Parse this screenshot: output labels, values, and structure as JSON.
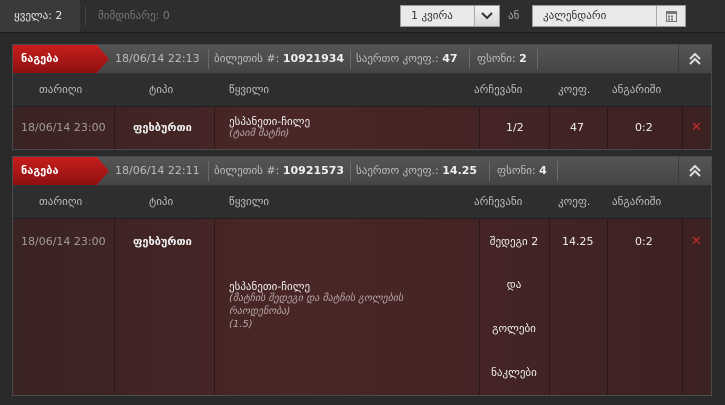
{
  "topbar": {
    "tab_all": "ყველა: 2",
    "tab_pending": "მიმდინარე: 0",
    "period_select": "1 კვირა",
    "and_label": "ან",
    "calendar_field": "კალენდარი"
  },
  "bets": [
    {
      "badge": "ნაგება",
      "datetime": "18/06/14 22:13",
      "ticket_label": "ბილეთის #:",
      "ticket_no": "10921934",
      "odds_label": "საერთო კოეფ.:",
      "odds": "47",
      "stake_label": "ფსონი:",
      "stake": "2",
      "columns": {
        "date": "თარიღი",
        "type": "ტიპი",
        "event": "წყვილი",
        "choice": "არჩევანი",
        "coef": "კოეფ.",
        "score": "ანგარიში"
      },
      "row": {
        "date": "18/06/14 23:00",
        "type": "ფეხბურთი",
        "event": "ესპანეთი-ჩილე",
        "market": "(ტაიმ მატჩი)",
        "choice": "1/2",
        "coef": "47",
        "score": "0:2"
      }
    },
    {
      "badge": "ნაგება",
      "datetime": "18/06/14 22:11",
      "ticket_label": "ბილეთის #:",
      "ticket_no": "10921573",
      "odds_label": "საერთო კოეფ.:",
      "odds": "14.25",
      "stake_label": "ფსონი:",
      "stake": "4",
      "columns": {
        "date": "თარიღი",
        "type": "ტიპი",
        "event": "წყვილი",
        "choice": "არჩევანი",
        "coef": "კოეფ.",
        "score": "ანგარიში"
      },
      "row": {
        "date": "18/06/14 23:00",
        "type": "ფეხბურთი",
        "event": "ესპანეთი-ჩილე",
        "market_line1": "(მატჩის შედეგი და მატჩის გოლების",
        "market_line2": "რაოდენობა)",
        "market_line3": "(1.5)",
        "choice_lines": [
          "შედეგი 2",
          "და",
          "გოლები",
          "ნაკლები"
        ],
        "coef": "14.25",
        "score": "0:2"
      }
    }
  ],
  "icons": {
    "dropdown": "chevron-down-icon",
    "calendar": "calendar-icon",
    "collapse": "double-chevron-up-icon",
    "remove": "close-icon"
  },
  "colors": {
    "badge": "#b01818",
    "remove": "#c42a2a",
    "row_bg": "#4a2626"
  }
}
